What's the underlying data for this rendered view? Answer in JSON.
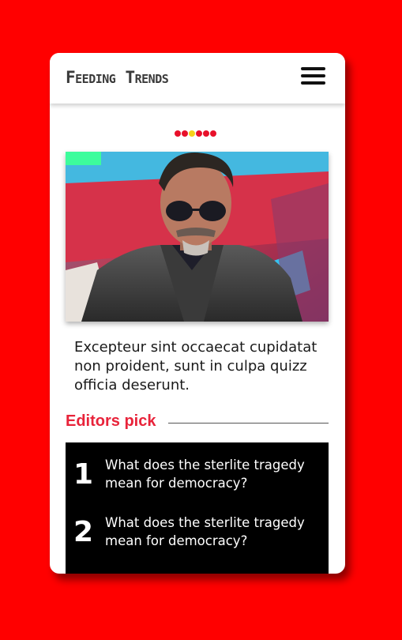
{
  "header": {
    "brand": "Feeding Trends",
    "menu_icon": "hamburger-menu-icon"
  },
  "carousel": {
    "slide_count": 6,
    "active_index": 2
  },
  "hero": {
    "image": "Portrait of a man in aviator sunglasses and a leather jacket against a red and blue background"
  },
  "article": {
    "caption": "Excepteur sint occaecat cupidatat non proident, sunt in culpa quizz officia deserunt."
  },
  "editors_pick": {
    "title": "Editors pick",
    "items": [
      {
        "number": "1",
        "title": "What does the sterlite tragedy mean for democracy?"
      },
      {
        "number": "2",
        "title": "What does the sterlite tragedy mean for democracy?"
      }
    ]
  },
  "colors": {
    "background": "#ff0000",
    "accent_red": "#e8233a",
    "active_dot": "#f5d21a",
    "tag_green": "#3dfc9c"
  }
}
